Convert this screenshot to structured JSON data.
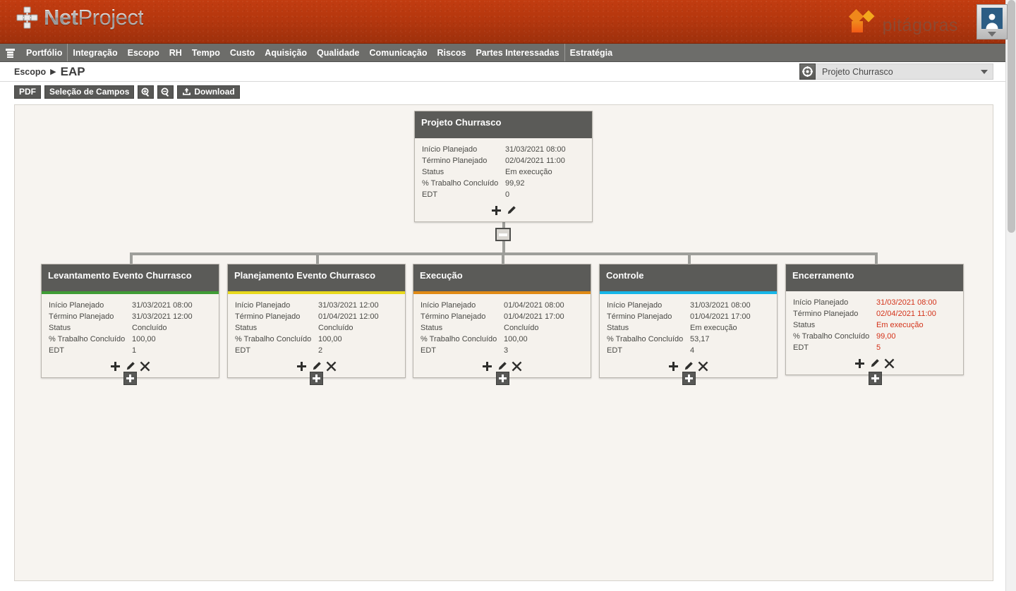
{
  "app": {
    "brand_bold": "Net",
    "brand_light": "Project",
    "partner_logo_text": "pitágoras",
    "user_menu_label": "user-account-menu"
  },
  "nav": {
    "menu_icon": "list-menu-icon",
    "items": [
      {
        "label": "Portfólio",
        "separator": false
      },
      {
        "label": "Integração",
        "separator": true
      },
      {
        "label": "Escopo",
        "separator": false
      },
      {
        "label": "RH",
        "separator": false
      },
      {
        "label": "Tempo",
        "separator": false
      },
      {
        "label": "Custo",
        "separator": false
      },
      {
        "label": "Aquisição",
        "separator": false
      },
      {
        "label": "Qualidade",
        "separator": false
      },
      {
        "label": "Comunicação",
        "separator": false
      },
      {
        "label": "Riscos",
        "separator": false
      },
      {
        "label": "Partes Interessadas",
        "separator": false
      },
      {
        "label": "Estratégia",
        "separator": true
      }
    ]
  },
  "breadcrumb": {
    "parent": "Escopo",
    "separator": "▶",
    "current": "EAP"
  },
  "project_selector": {
    "icon": "target-icon",
    "value": "Projeto Churrasco",
    "caret": "chevron-down-icon"
  },
  "toolbar": {
    "pdf_label": "PDF",
    "fields_label": "Seleção de Campos",
    "zoom_in_icon": "zoom-in-icon",
    "zoom_out_icon": "zoom-out-icon",
    "download_label": "Download",
    "download_icon": "download-tray-icon"
  },
  "field_labels": {
    "start": "Início Planejado",
    "finish": "Término Planejado",
    "status": "Status",
    "work_done": "% Trabalho Concluído",
    "wbs": "EDT"
  },
  "actions": {
    "add": "add-icon",
    "edit": "edit-pencil-icon",
    "delete": "delete-icon",
    "collapse": "collapse-node-button",
    "expand": "expand-node-button"
  },
  "tree": {
    "root": {
      "title": "Projeto Churrasco",
      "accent": "",
      "value_color": "#4a4a46",
      "start": "31/03/2021 08:00",
      "finish": "02/04/2021 11:00",
      "status": "Em execução",
      "work_done": "99,92",
      "wbs": "0",
      "has_delete": false,
      "has_expand_below": false
    },
    "children": [
      {
        "title": "Levantamento Evento Churrasco",
        "accent": "#3f9c35",
        "value_color": "#4a4a46",
        "start": "31/03/2021 08:00",
        "finish": "31/03/2021 12:00",
        "status": "Concluído",
        "work_done": "100,00",
        "wbs": "1",
        "has_delete": true,
        "has_expand_below": true
      },
      {
        "title": "Planejamento Evento Churrasco",
        "accent": "#e8d91c",
        "value_color": "#4a4a46",
        "start": "31/03/2021 12:00",
        "finish": "01/04/2021 12:00",
        "status": "Concluído",
        "work_done": "100,00",
        "wbs": "2",
        "has_delete": true,
        "has_expand_below": true
      },
      {
        "title": "Execução",
        "accent": "#e08a16",
        "value_color": "#4a4a46",
        "start": "01/04/2021 08:00",
        "finish": "01/04/2021 17:00",
        "status": "Concluído",
        "work_done": "100,00",
        "wbs": "3",
        "has_delete": true,
        "has_expand_below": true
      },
      {
        "title": "Controle",
        "accent": "#17b6e8",
        "value_color": "#4a4a46",
        "start": "31/03/2021 08:00",
        "finish": "01/04/2021 17:00",
        "status": "Em execução",
        "work_done": "53,17",
        "wbs": "4",
        "has_delete": true,
        "has_expand_below": true
      },
      {
        "title": "Encerramento",
        "accent": "",
        "value_color": "#d4331a",
        "start": "31/03/2021 08:00",
        "finish": "02/04/2021 11:00",
        "status": "Em execução",
        "work_done": "99,00",
        "wbs": "5",
        "has_delete": true,
        "has_expand_below": true
      }
    ]
  },
  "colors": {
    "header_orange": "#b5370e",
    "nav_gray": "#6d6d6a",
    "card_header": "#5b5b58",
    "canvas_bg": "#f7f4f0"
  }
}
